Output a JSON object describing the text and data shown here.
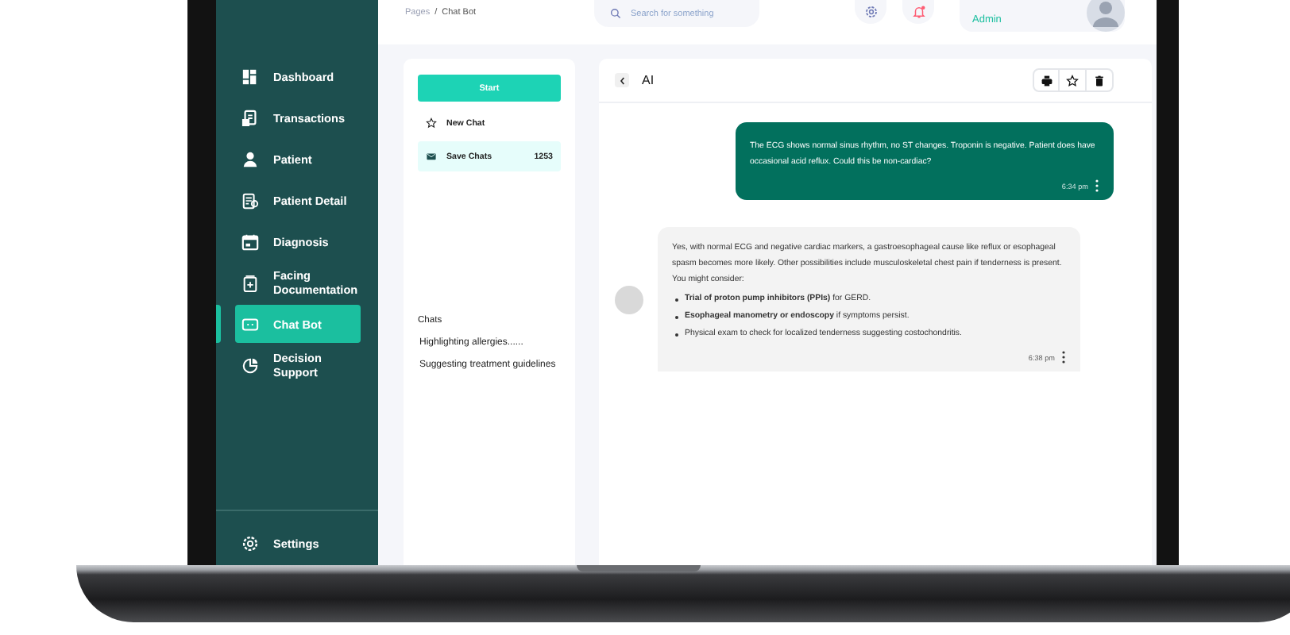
{
  "breadcrumb": {
    "parent": "Pages",
    "separator": "/",
    "current": "Chat Bot"
  },
  "search": {
    "placeholder": "Search for something"
  },
  "notifications": {
    "unread": true
  },
  "user": {
    "role": "Admin"
  },
  "sidebar": {
    "items": [
      {
        "label": "Dashboard",
        "selected": false
      },
      {
        "label": "Transactions",
        "selected": false
      },
      {
        "label": "Patient",
        "selected": false
      },
      {
        "label": "Patient Detail",
        "selected": false
      },
      {
        "label": "Diagnosis",
        "selected": false
      },
      {
        "label": "Facing Documentation",
        "selected": false
      },
      {
        "label": "Chat Bot",
        "selected": true
      },
      {
        "label": "Decision Support",
        "selected": false
      }
    ],
    "footer": {
      "label": "Settings"
    }
  },
  "chat_list": {
    "start_button": "Start",
    "items": [
      {
        "label": "New Chat",
        "selected": false
      },
      {
        "label": "Save Chats",
        "count": "1253",
        "selected": true
      }
    ],
    "history_title": "Chats",
    "history": [
      "Highlighting allergies......",
      "Suggesting treatment guidelines"
    ]
  },
  "chat": {
    "title": "AI",
    "messages": [
      {
        "kind": "user",
        "text": "The ECG shows normal sinus rhythm, no ST changes. Troponin is negative. Patient does have occasional acid reflux. Could this be non-cardiac?",
        "time": "6:34 pm"
      },
      {
        "kind": "bot",
        "text": "Yes, with normal ECG and negative cardiac markers, a gastroesophageal cause like reflux or esophageal spasm becomes more likely. Other possibilities include musculoskeletal chest pain if tenderness is present. You might consider:",
        "bullets": [
          "**Trial of proton pump inhibitors (PPIs)** for GERD.",
          "**Esophageal manometry or endoscopy** if symptoms persist.",
          "Physical exam to check for localized tenderness suggesting costochondritis."
        ],
        "time": "6:38 pm"
      }
    ]
  }
}
